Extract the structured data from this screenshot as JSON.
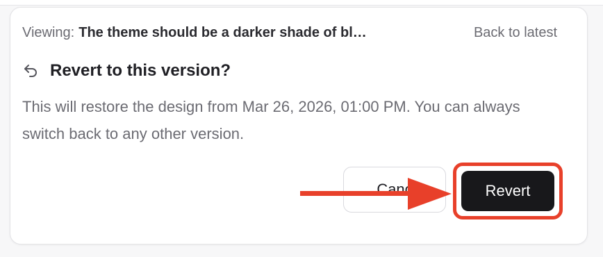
{
  "window": {
    "viewing_label": "Viewing:",
    "viewing_title": "The theme should be a darker shade of bl…",
    "back_link": "Back to latest"
  },
  "dialog": {
    "icon": "undo-icon",
    "title": "Revert to this version?",
    "description": "This will restore the design from Mar 26, 2026, 01:00 PM. You can always switch back to any other version.",
    "cancel_label": "Canc",
    "revert_label": "Revert"
  },
  "annotation": {
    "icon": "red-arrow",
    "highlight_color": "#e8402a"
  },
  "colors": {
    "accent": "#18181b",
    "annotation_red": "#e8402a",
    "muted_text": "#6b6b72"
  }
}
